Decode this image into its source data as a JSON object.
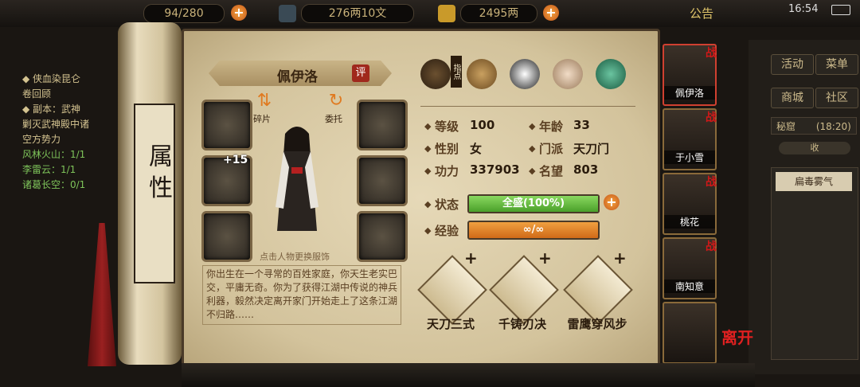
{
  "topbar": {
    "stamina": "94/280",
    "currency1": "276两10文",
    "currency2": "2495两",
    "announcement": "公告",
    "time": "16:54"
  },
  "quest_panel": {
    "lines": [
      {
        "text": "◆ 侠血染昆仑",
        "style": "normal"
      },
      {
        "text": "卷回顾",
        "style": "normal"
      },
      {
        "text": "◆ 副本：武神",
        "style": "normal"
      },
      {
        "text": "剿灭武神殿中诸",
        "style": "normal"
      },
      {
        "text": "空方势力",
        "style": "normal"
      },
      {
        "text": "风林火山：1/1",
        "style": "green"
      },
      {
        "text": "李雷云：1/1",
        "style": "green"
      },
      {
        "text": "诸葛长空：0/1",
        "style": "green"
      }
    ]
  },
  "right_menu": {
    "buttons": [
      "活动",
      "菜单",
      "商城",
      "社区"
    ],
    "secret": "秘窟",
    "secret_time": "(18:20)",
    "collapse": "收",
    "buff": "扁毒雾气"
  },
  "scroll_title": "属 性",
  "character": {
    "name": "佩伊洛",
    "rate_badge": "评",
    "fragments_label": "碎片",
    "entrust_label": "委托",
    "change_outfit_hint": "点击人物更换服饰",
    "weapon_bonus": "+15",
    "description": "你出生在一个寻常的百姓家庭，你天生老实巴交，平庸无奇。你为了获得江湖中传说的神兵利器，毅然决定离开家门开始走上了这条江湖不归路……"
  },
  "tabs": {
    "guide_label": "指点"
  },
  "stats": {
    "level_label": "等级",
    "level": "100",
    "age_label": "年龄",
    "age": "33",
    "gender_label": "性别",
    "gender": "女",
    "sect_label": "门派",
    "sect": "天刀门",
    "power_label": "功力",
    "power": "337903",
    "fame_label": "名望",
    "fame": "803",
    "status_label": "状态",
    "status_value": "全盛(100%)",
    "status_fill": 1.0,
    "exp_label": "经验",
    "exp_value": "∞/∞"
  },
  "skills": [
    {
      "name": "天刀三式",
      "plus": "+"
    },
    {
      "name": "千铸刃决",
      "plus": "+"
    },
    {
      "name": "雷鹰穿风步",
      "plus": "+"
    }
  ],
  "party": [
    {
      "name": "佩伊洛",
      "tag": "战"
    },
    {
      "name": "于小雪",
      "tag": "战"
    },
    {
      "name": "桃花",
      "tag": "战"
    },
    {
      "name": "南知意",
      "tag": "战"
    },
    {
      "name": "",
      "tag": ""
    }
  ],
  "leave_label": "离开",
  "colors": {
    "status_bar": "#5fb83a",
    "exp_bar": "#e07a20",
    "accent_red": "#d01818"
  }
}
